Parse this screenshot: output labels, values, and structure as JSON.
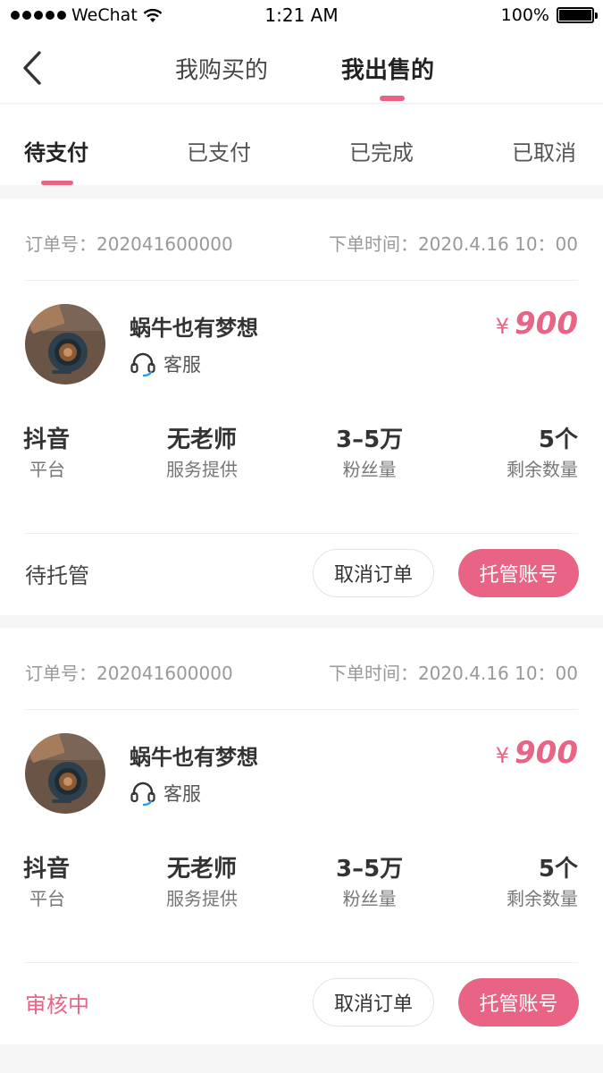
{
  "status_bar": {
    "carrier": "WeChat",
    "time": "1:21 AM",
    "battery": "100%"
  },
  "nav": {
    "tabs": [
      "我购买的",
      "我出售的"
    ],
    "active_tab": "我出售的"
  },
  "sub_tabs": {
    "items": [
      "待支付",
      "已支付",
      "已完成",
      "已取消"
    ],
    "active": "待支付"
  },
  "colors": {
    "accent": "#e96384",
    "service_icon": "#2b9ce8"
  },
  "orders": [
    {
      "order_no": "订单号：202041600000",
      "order_time": "下单时间：2020.4.16 10：00",
      "seller": "蜗牛也有梦想",
      "service_label": "客服",
      "currency": "¥",
      "price": "900",
      "stats": [
        {
          "value": "抖音",
          "label": "平台"
        },
        {
          "value": "无老师",
          "label": "服务提供"
        },
        {
          "value": "3–5万",
          "label": "粉丝量"
        },
        {
          "value": "5个",
          "label": "剩余数量"
        }
      ],
      "status": "待托管",
      "cancel_label": "取消订单",
      "host_label": "托管账号"
    },
    {
      "order_no": "订单号：202041600000",
      "order_time": "下单时间：2020.4.16 10：00",
      "seller": "蜗牛也有梦想",
      "service_label": "客服",
      "currency": "¥",
      "price": "900",
      "stats": [
        {
          "value": "抖音",
          "label": "平台"
        },
        {
          "value": "无老师",
          "label": "服务提供"
        },
        {
          "value": "3–5万",
          "label": "粉丝量"
        },
        {
          "value": "5个",
          "label": "剩余数量"
        }
      ],
      "status": "审核中",
      "cancel_label": "取消订单",
      "host_label": "托管账号"
    }
  ]
}
